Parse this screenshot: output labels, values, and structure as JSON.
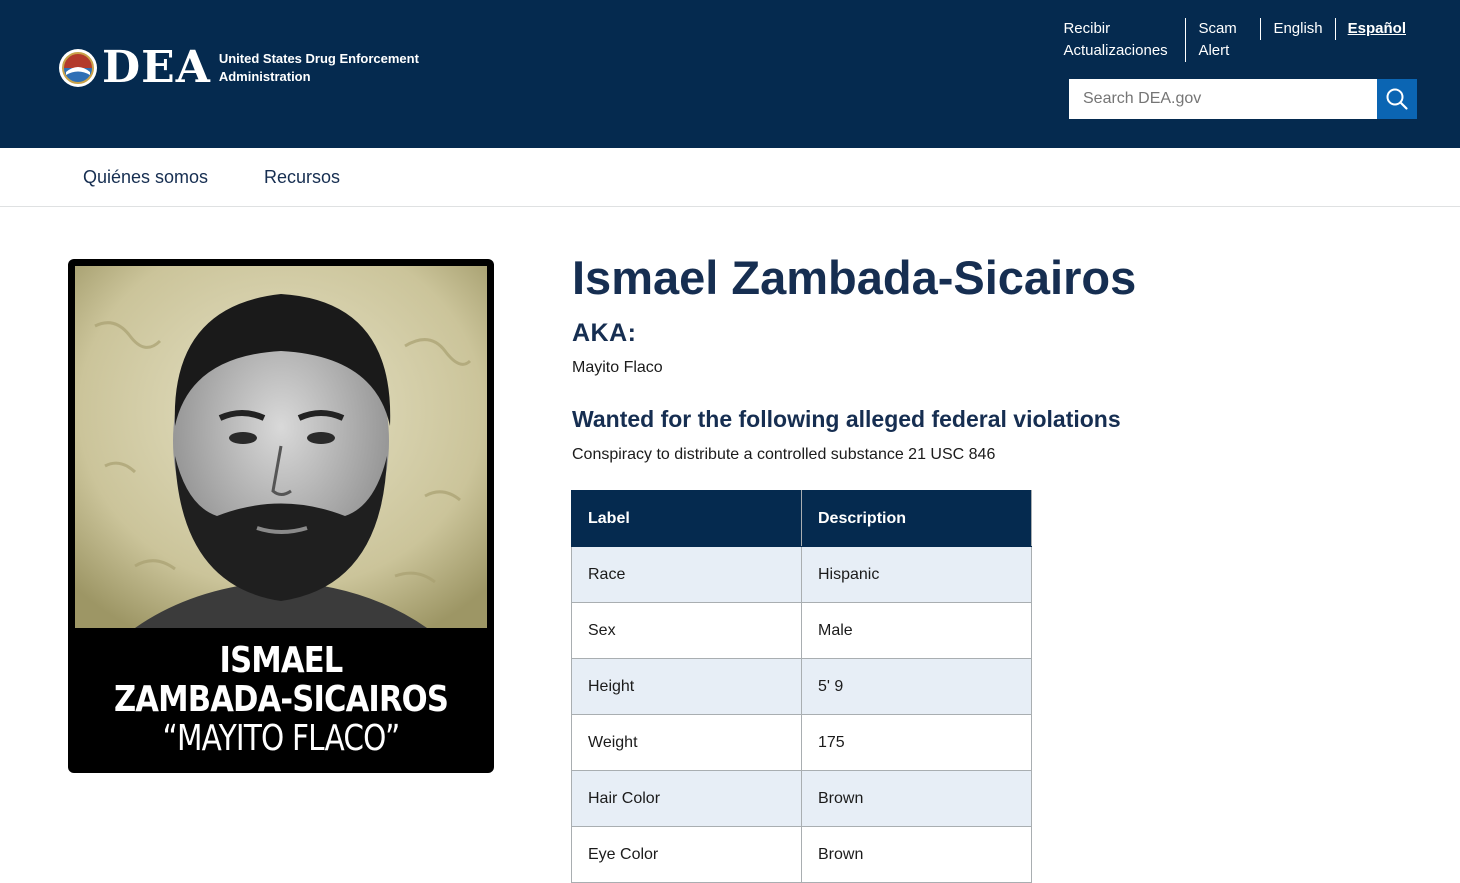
{
  "header": {
    "agency_name": "United States Drug Enforcement Administration",
    "logo_text": "DEA",
    "utility_links": [
      {
        "label": "Recibir Actualizaciones"
      },
      {
        "label": "Scam Alert"
      },
      {
        "label": "English"
      },
      {
        "label": "Español",
        "active": true
      }
    ],
    "search": {
      "placeholder": "Search DEA.gov",
      "value": "",
      "button_icon": "search-icon"
    },
    "colors": {
      "header_bg": "#052a4f",
      "search_button": "#0b65b3"
    }
  },
  "main_nav": {
    "items": [
      {
        "label": "Quiénes somos"
      },
      {
        "label": "Recursos"
      }
    ]
  },
  "poster": {
    "line1": "ISMAEL",
    "line2": "ZAMBADA-SICAIROS",
    "line3": "“MAYITO FLACO”"
  },
  "fugitive": {
    "name": "Ismael Zambada-Sicairos",
    "aka_label": "AKA:",
    "aka_value": "Mayito Flaco",
    "violations_heading": "Wanted for the following alleged federal violations",
    "violations_text": "Conspiracy to distribute a controlled substance 21 USC 846"
  },
  "details_table": {
    "headers": [
      "Label",
      "Description"
    ],
    "rows": [
      [
        "Race",
        "Hispanic"
      ],
      [
        "Sex",
        "Male"
      ],
      [
        "Height",
        "5' 9"
      ],
      [
        "Weight",
        "175"
      ],
      [
        "Hair Color",
        "Brown"
      ],
      [
        "Eye Color",
        "Brown"
      ]
    ]
  }
}
